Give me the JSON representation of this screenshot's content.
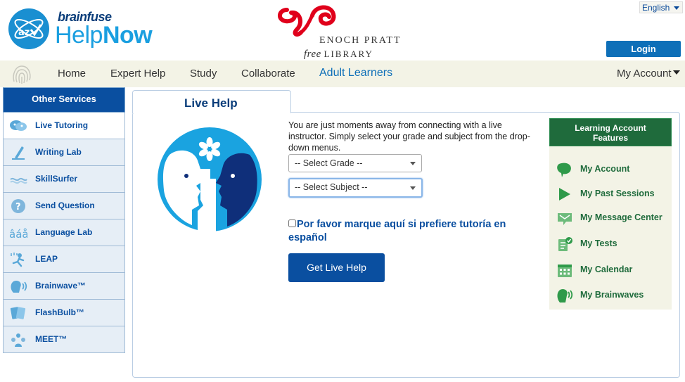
{
  "header": {
    "brand_small": "brainfuse",
    "brand_help": "Help",
    "brand_now": "Now",
    "library_line1": "ENOCH PRATT",
    "library_free": "free",
    "library_lib": "LIBRARY",
    "language": "English",
    "login_label": "Login"
  },
  "nav": {
    "items": [
      "Home",
      "Expert Help",
      "Study",
      "Collaborate",
      "Adult Learners"
    ],
    "active": "Adult Learners",
    "account_label": "My Account"
  },
  "sidebar": {
    "title": "Other Services",
    "items": [
      {
        "label": "Live Tutoring",
        "icon": "chat-bubbles-icon"
      },
      {
        "label": "Writing Lab",
        "icon": "pencil-icon"
      },
      {
        "label": "SkillSurfer",
        "icon": "wave-icon"
      },
      {
        "label": "Send Question",
        "icon": "question-mark-icon"
      },
      {
        "label": "Language Lab",
        "icon": "accented-letters-icon"
      },
      {
        "label": "LEAP",
        "icon": "leap-icon"
      },
      {
        "label": "Brainwave™",
        "icon": "brainwave-icon"
      },
      {
        "label": "FlashBulb™",
        "icon": "flashcards-icon"
      },
      {
        "label": "MEET™",
        "icon": "meet-people-icon"
      }
    ]
  },
  "main": {
    "tab_label": "Live Help",
    "intro": "You are just moments away from connecting with a live instructor. Simply select your grade and subject from the drop-down menus.",
    "grade_placeholder": "-- Select Grade --",
    "subject_placeholder": "-- Select Subject --",
    "spanish_label": "Por favor marque aquí si prefiere tutoría en español",
    "live_help_button": "Get Live Help"
  },
  "features": {
    "title_line1": "Learning Account",
    "title_line2": "Features",
    "items": [
      {
        "label": "My Account",
        "icon": "speech-bubble-icon"
      },
      {
        "label": "My Past Sessions",
        "icon": "play-icon"
      },
      {
        "label": "My Message Center",
        "icon": "envelope-icon"
      },
      {
        "label": "My Tests",
        "icon": "test-clipboard-icon"
      },
      {
        "label": "My Calendar",
        "icon": "calendar-icon"
      },
      {
        "label": "My Brainwaves",
        "icon": "brainwave-icon"
      }
    ]
  },
  "colors": {
    "brand_blue": "#1a9fe0",
    "nav_active": "#0e6fb8",
    "sidebar_head": "#0a4fa0",
    "feature_green": "#1f6b3c",
    "pratt_red": "#e0001b"
  }
}
